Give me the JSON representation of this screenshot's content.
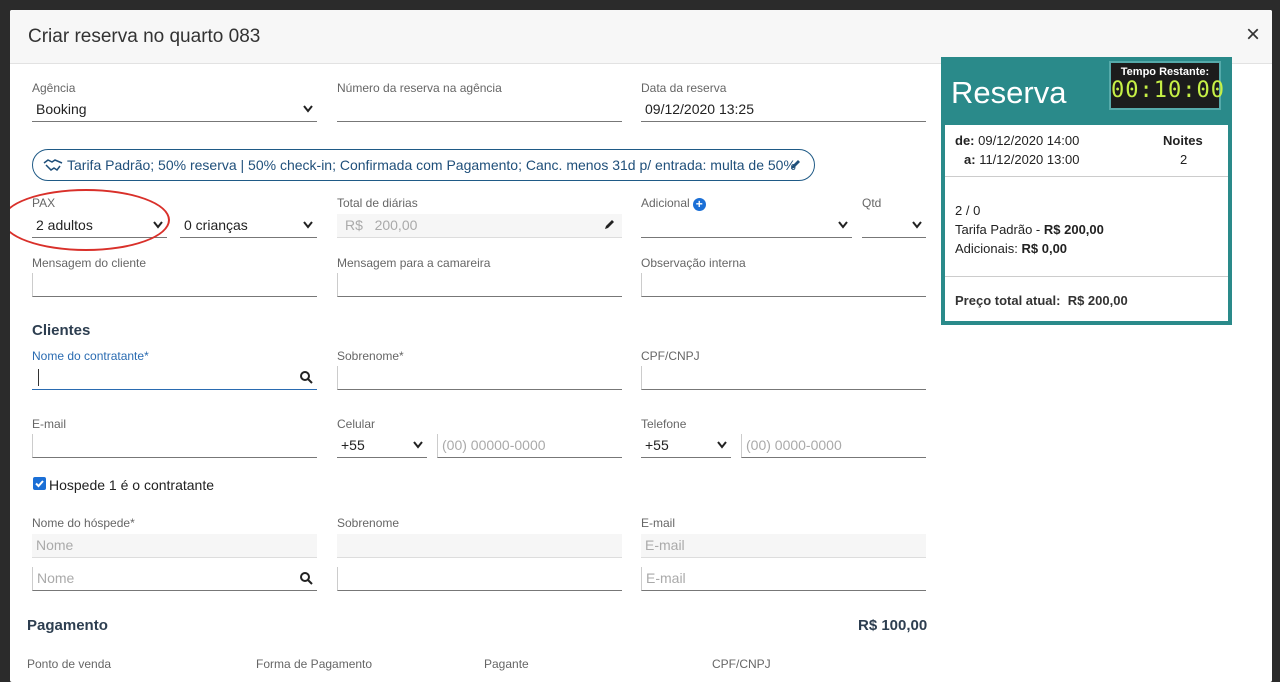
{
  "modal": {
    "title": "Criar reserva no quarto 083",
    "close": "×"
  },
  "agency": {
    "label": "Agência",
    "value": "Booking"
  },
  "booking_number": {
    "label": "Número da reserva na agência",
    "value": ""
  },
  "booking_date": {
    "label": "Data da reserva",
    "value": "09/12/2020 13:25"
  },
  "tariff": {
    "text": "Tarifa Padrão; 50% reserva | 50% check-in; Confirmada com Pagamento; Canc. menos 31d p/ entrada: multa de 50%"
  },
  "pax": {
    "label": "PAX",
    "adults": "2 adultos",
    "children": "0 crianças"
  },
  "daily_total": {
    "label": "Total de diárias",
    "currency": "R$",
    "value": "200,00"
  },
  "additional": {
    "label": "Adicional",
    "value": ""
  },
  "qty": {
    "label": "Qtd",
    "value": ""
  },
  "client_message": {
    "label": "Mensagem do cliente"
  },
  "maid_message": {
    "label": "Mensagem para a camareira"
  },
  "internal_note": {
    "label": "Observação interna"
  },
  "clients": {
    "title": "Clientes",
    "contractor_name": "Nome do contratante*",
    "surname": "Sobrenome*",
    "cpf": "CPF/CNPJ",
    "email": "E-mail",
    "mobile": {
      "label": "Celular",
      "code": "+55",
      "placeholder": "(00) 00000-0000"
    },
    "phone": {
      "label": "Telefone",
      "code": "+55",
      "placeholder": "(00) 0000-0000"
    },
    "guest1_is_contractor": "Hospede 1 é o contratante",
    "guest_name": "Nome do hóspede*",
    "guest_surname": "Sobrenome",
    "guest_email": "E-mail",
    "name_placeholder": "Nome",
    "email_placeholder": "E-mail"
  },
  "payment": {
    "title": "Pagamento",
    "amount": "R$ 100,00",
    "cols": [
      "Ponto de venda",
      "Forma de Pagamento",
      "Pagante",
      "CPF/CNPJ"
    ]
  },
  "summary": {
    "title": "Reserva",
    "timer_label": "Tempo Restante:",
    "timer_value": "00:10:00",
    "from_label": "de:",
    "from_value": "09/12/2020 14:00",
    "to_label": "a:",
    "to_value": "11/12/2020 13:00",
    "nights_label": "Noites",
    "nights_value": "2",
    "pax": "2 / 0",
    "tariff_label": "Tarifa Padrão -",
    "tariff_value": "R$ 200,00",
    "additional_label": "Adicionais:",
    "additional_value": "R$ 0,00",
    "total_label": "Preço total atual:",
    "total_value": "R$ 200,00"
  }
}
